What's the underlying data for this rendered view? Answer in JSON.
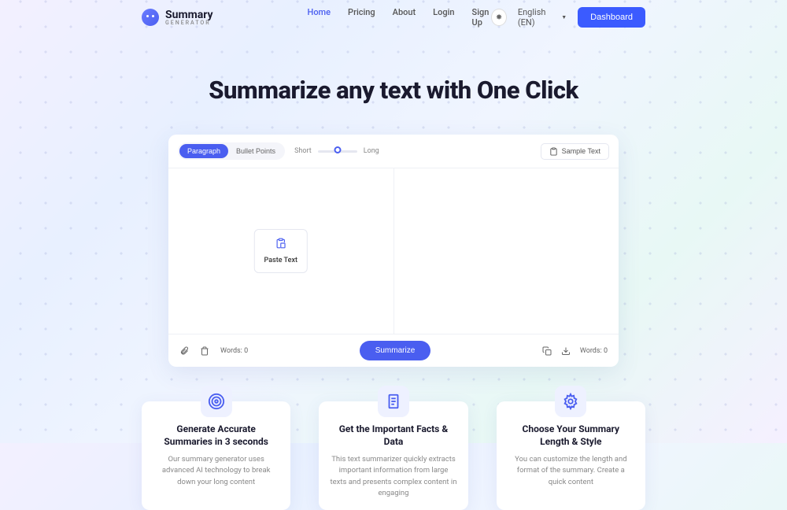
{
  "brand": {
    "title": "Summary",
    "subtitle": "GENERATOR"
  },
  "nav": {
    "links": [
      "Home",
      "Pricing",
      "About",
      "Login",
      "Sign Up"
    ],
    "language": "English (EN)",
    "dashboard": "Dashboard"
  },
  "hero": {
    "title": "Summarize any text with One Click"
  },
  "editor": {
    "modes": {
      "paragraph": "Paragraph",
      "bullet": "Bullet Points"
    },
    "length": {
      "short": "Short",
      "long": "Long"
    },
    "sample": "Sample Text",
    "paste": "Paste Text",
    "wordsLabelLeft": "Words: 0",
    "wordsLabelRight": "Words: 0",
    "summarize": "Summarize"
  },
  "features": [
    {
      "title": "Generate Accurate Summaries in 3 seconds",
      "desc": "Our summary generator uses advanced AI technology to break down your long content"
    },
    {
      "title": "Get the Important Facts & Data",
      "desc": "This text summarizer quickly extracts important information from large texts and presents complex content in engaging"
    },
    {
      "title": "Choose Your Summary Length & Style",
      "desc": "You can customize the length and format of the summary. Create a quick content"
    }
  ]
}
